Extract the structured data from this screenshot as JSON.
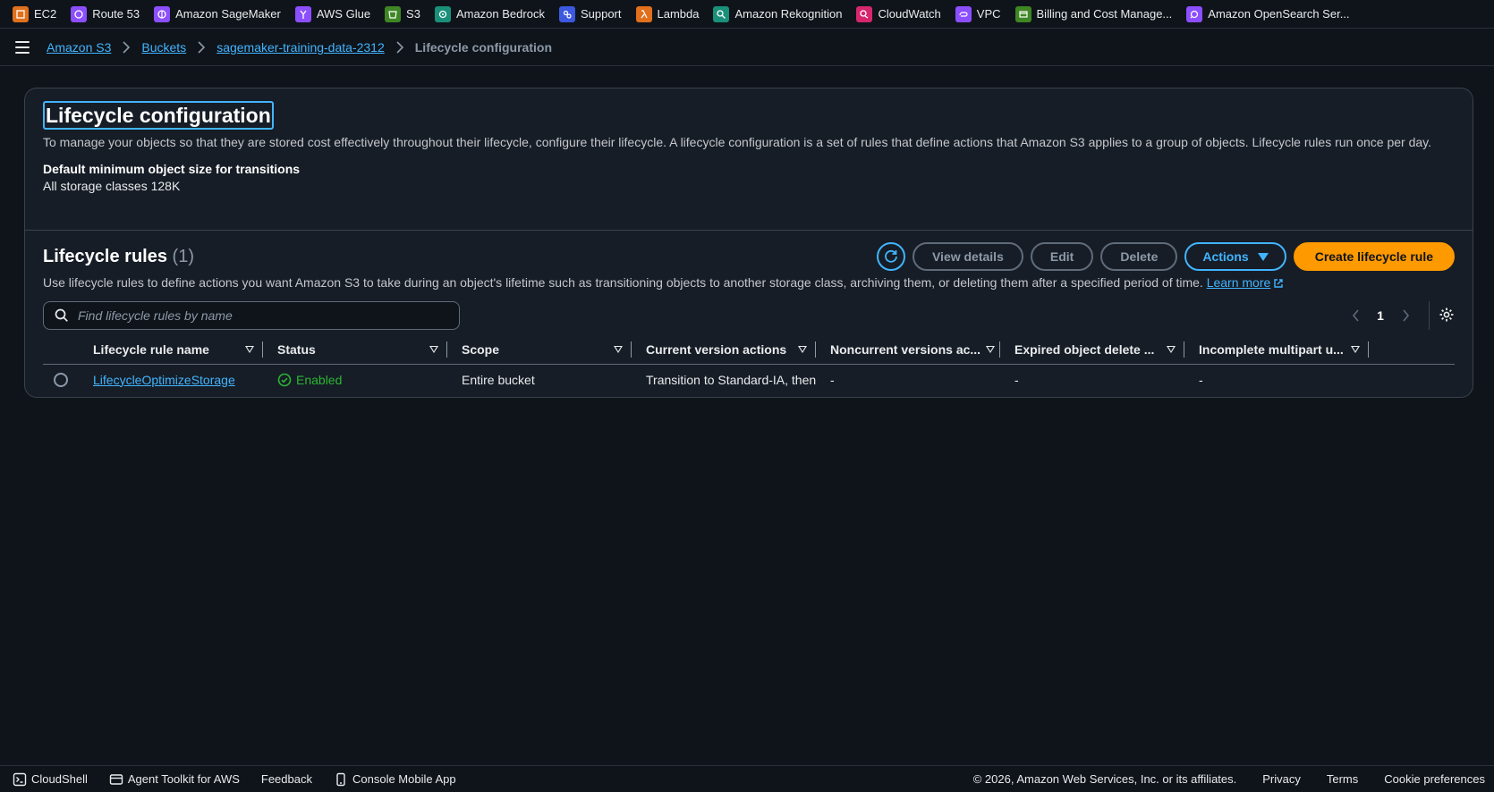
{
  "favorites": [
    {
      "label": "EC2",
      "icon": "ec2-icon",
      "color": "#e0701c"
    },
    {
      "label": "Route 53",
      "icon": "route53-icon",
      "color": "#8c4fff"
    },
    {
      "label": "Amazon SageMaker",
      "icon": "sagemaker-icon",
      "color": "#8c4fff"
    },
    {
      "label": "AWS Glue",
      "icon": "glue-icon",
      "color": "#8c4fff"
    },
    {
      "label": "S3",
      "icon": "s3-icon",
      "color": "#3f8624"
    },
    {
      "label": "Amazon Bedrock",
      "icon": "bedrock-icon",
      "color": "#1a8f7a"
    },
    {
      "label": "Support",
      "icon": "support-icon",
      "color": "#3c59e0"
    },
    {
      "label": "Lambda",
      "icon": "lambda-icon",
      "color": "#e0701c"
    },
    {
      "label": "Amazon Rekognition",
      "icon": "rekognition-icon",
      "color": "#1a8f7a"
    },
    {
      "label": "CloudWatch",
      "icon": "cloudwatch-icon",
      "color": "#d6266e"
    },
    {
      "label": "VPC",
      "icon": "vpc-icon",
      "color": "#8c4fff"
    },
    {
      "label": "Billing and Cost Manage...",
      "icon": "billing-icon",
      "color": "#3f8624"
    },
    {
      "label": "Amazon OpenSearch Ser...",
      "icon": "opensearch-icon",
      "color": "#8c4fff"
    }
  ],
  "breadcrumb": {
    "items": [
      "Amazon S3",
      "Buckets",
      "sagemaker-training-data-2312"
    ],
    "current": "Lifecycle configuration"
  },
  "header": {
    "title": "Lifecycle configuration",
    "description": "To manage your objects so that they are stored cost effectively throughout their lifecycle, configure their lifecycle. A lifecycle configuration is a set of rules that define actions that Amazon S3 applies to a group of objects. Lifecycle rules run once per day.",
    "min_size_label": "Default minimum object size for transitions",
    "min_size_value": "All storage classes 128K"
  },
  "rules": {
    "title": "Lifecycle rules",
    "count": "(1)",
    "buttons": {
      "view_details": "View details",
      "edit": "Edit",
      "delete": "Delete",
      "actions": "Actions",
      "create": "Create lifecycle rule"
    },
    "description": "Use lifecycle rules to define actions you want Amazon S3 to take during an object's lifetime such as transitioning objects to another storage class, archiving them, or deleting them after a specified period of time.",
    "learn_more": "Learn more",
    "search_placeholder": "Find lifecycle rules by name",
    "page": "1",
    "columns": [
      "Lifecycle rule name",
      "Status",
      "Scope",
      "Current version actions",
      "Noncurrent versions ac...",
      "Expired object delete ...",
      "Incomplete multipart u..."
    ],
    "rows": [
      {
        "name": "LifecycleOptimizeStorage",
        "status": "Enabled",
        "scope": "Entire bucket",
        "current": "Transition to Standard-IA, then I",
        "noncurrent": "-",
        "expired": "-",
        "incomplete": "-"
      }
    ]
  },
  "footer": {
    "cloudshell": "CloudShell",
    "toolkit": "Agent Toolkit for AWS",
    "feedback": "Feedback",
    "mobile": "Console Mobile App",
    "copyright": "© 2026, Amazon Web Services, Inc. or its affiliates.",
    "privacy": "Privacy",
    "terms": "Terms",
    "cookies": "Cookie preferences"
  },
  "colors": {
    "accent": "#42b4ff",
    "primary": "#ff9900",
    "success": "#2bb534",
    "background": "#0f141a"
  }
}
